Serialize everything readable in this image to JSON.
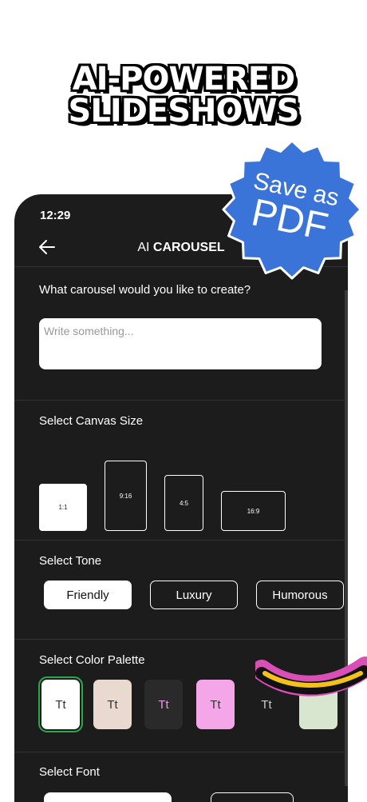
{
  "promo": {
    "headline_line1": "AI-POWERED",
    "headline_line2": "SLIDESHOWS",
    "badge_line1": "Save as",
    "badge_line2": "PDF"
  },
  "status_bar": {
    "time": "12:29"
  },
  "nav": {
    "title_prefix": "AI",
    "title_main": "CAROUSEL"
  },
  "prompt": {
    "label": "What carousel would you like to create?",
    "placeholder": "Write something..."
  },
  "canvas": {
    "label": "Select Canvas Size",
    "options": [
      "1:1",
      "9:16",
      "4:5",
      "16:9"
    ],
    "selected": "1:1"
  },
  "tone": {
    "label": "Select Tone",
    "options": [
      "Friendly",
      "Luxury",
      "Humorous"
    ],
    "selected": "Friendly"
  },
  "palette": {
    "label": "Select Color Palette",
    "swatches": [
      {
        "text": "Tt",
        "bg": "#ffffff",
        "fg": "#333333"
      },
      {
        "text": "Tt",
        "bg": "#ead9cf",
        "fg": "#333333"
      },
      {
        "text": "Tt",
        "bg": "#2a2a2a",
        "fg": "#e79ae6"
      },
      {
        "text": "Tt",
        "bg": "#f5a6e8",
        "fg": "#333333"
      },
      {
        "text": "Tt",
        "bg": "#1c1c1c",
        "fg": "#cccccc"
      },
      {
        "text": "",
        "bg": "#d9e6cf",
        "fg": "#333333"
      }
    ]
  },
  "font": {
    "label": "Select Font"
  },
  "colors": {
    "badge": "#3b74d9",
    "accent_green": "#2aa84a",
    "panel": "#1c1c1c"
  }
}
